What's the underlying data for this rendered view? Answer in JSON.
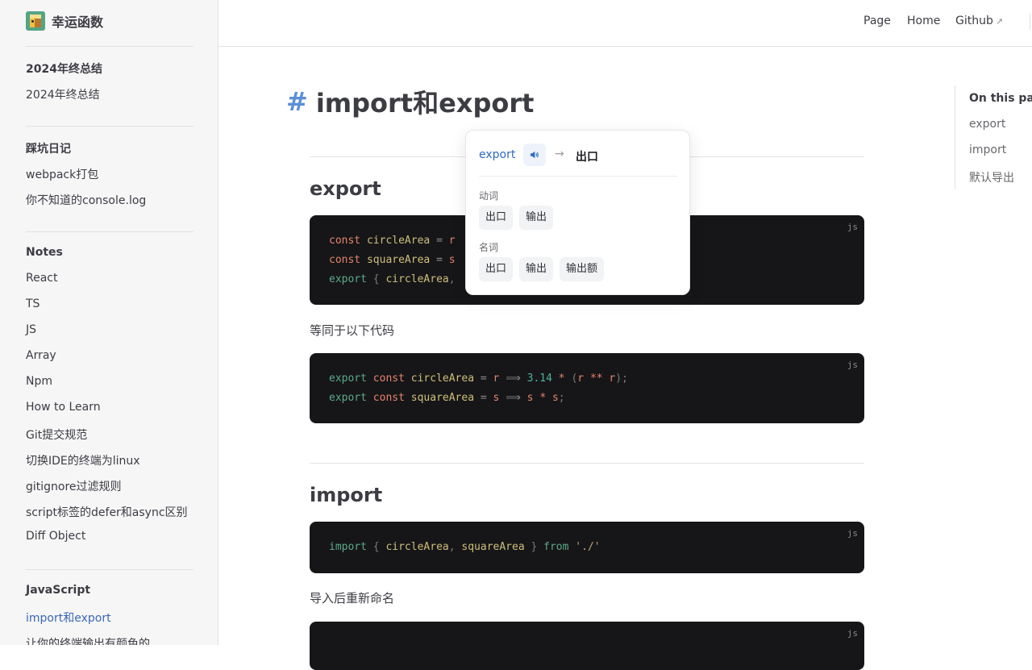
{
  "site": {
    "title": "幸运函数"
  },
  "sidebar": {
    "groups": [
      {
        "title": "2024年终总结",
        "items": [
          "2024年终总结"
        ]
      },
      {
        "title": "踩坑日记",
        "items": [
          "webpack打包",
          "你不知道的console.log"
        ]
      },
      {
        "title": "Notes",
        "items": [
          "React",
          "TS",
          "JS",
          "Array",
          "Npm",
          "How to Learn",
          "Git提交规范",
          "切换IDE的终端为linux",
          "gitignore过滤规则",
          "script标签的defer和async区别",
          "Diff Object"
        ]
      },
      {
        "title": "JavaScript",
        "items": [
          "import和export",
          "让你的终端输出有颜色的"
        ]
      }
    ],
    "active_item": "import和export"
  },
  "nav": {
    "links": [
      "Page",
      "Home",
      "Github"
    ],
    "external_marker": "↗"
  },
  "content": {
    "title_hash": "#",
    "title": "import和export",
    "sections": [
      {
        "heading": "export"
      },
      {
        "heading": "import"
      }
    ],
    "paragraphs": [
      "等同于以下代码",
      "导入后重新命名"
    ],
    "code_lang": "js"
  },
  "outline": {
    "title": "On this page",
    "items": [
      "export",
      "import",
      "默认导出"
    ]
  },
  "translation_popup": {
    "word": "export",
    "arrow": "→",
    "translation": "出口",
    "groups": [
      {
        "pos": "动词",
        "meanings": [
          "出口",
          "输出"
        ]
      },
      {
        "pos": "名词",
        "meanings": [
          "出口",
          "输出",
          "输出额"
        ]
      }
    ]
  },
  "colors": {
    "accent": "#3a67b8",
    "code_bg": "#161618",
    "hash": "#5b8fd6"
  }
}
